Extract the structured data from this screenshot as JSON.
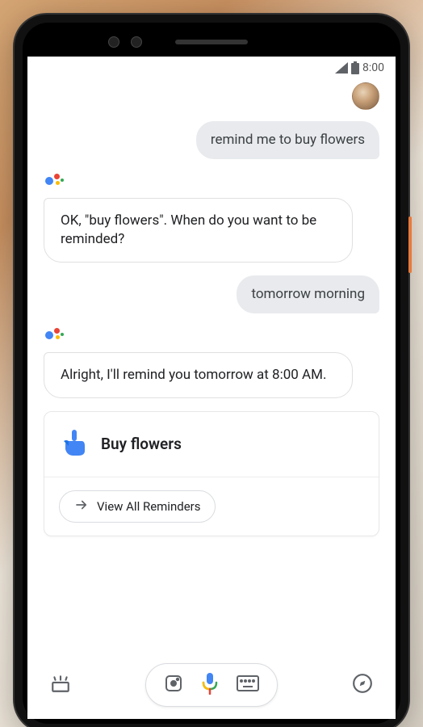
{
  "status": {
    "time": "8:00"
  },
  "conversation": {
    "user1": "remind me to buy flowers",
    "assistant1": "OK, \"buy flowers\". When do you want to be reminded?",
    "user2": "tomorrow morning",
    "assistant2": "Alright, I'll remind you tomorrow at 8:00 AM."
  },
  "reminder": {
    "title": "Buy flowers",
    "view_all": "View All Reminders"
  },
  "bottom": {
    "updates_icon": "updates-icon",
    "lens_icon": "lens-icon",
    "mic_icon": "mic-icon",
    "keyboard_icon": "keyboard-icon",
    "explore_icon": "explore-icon"
  }
}
